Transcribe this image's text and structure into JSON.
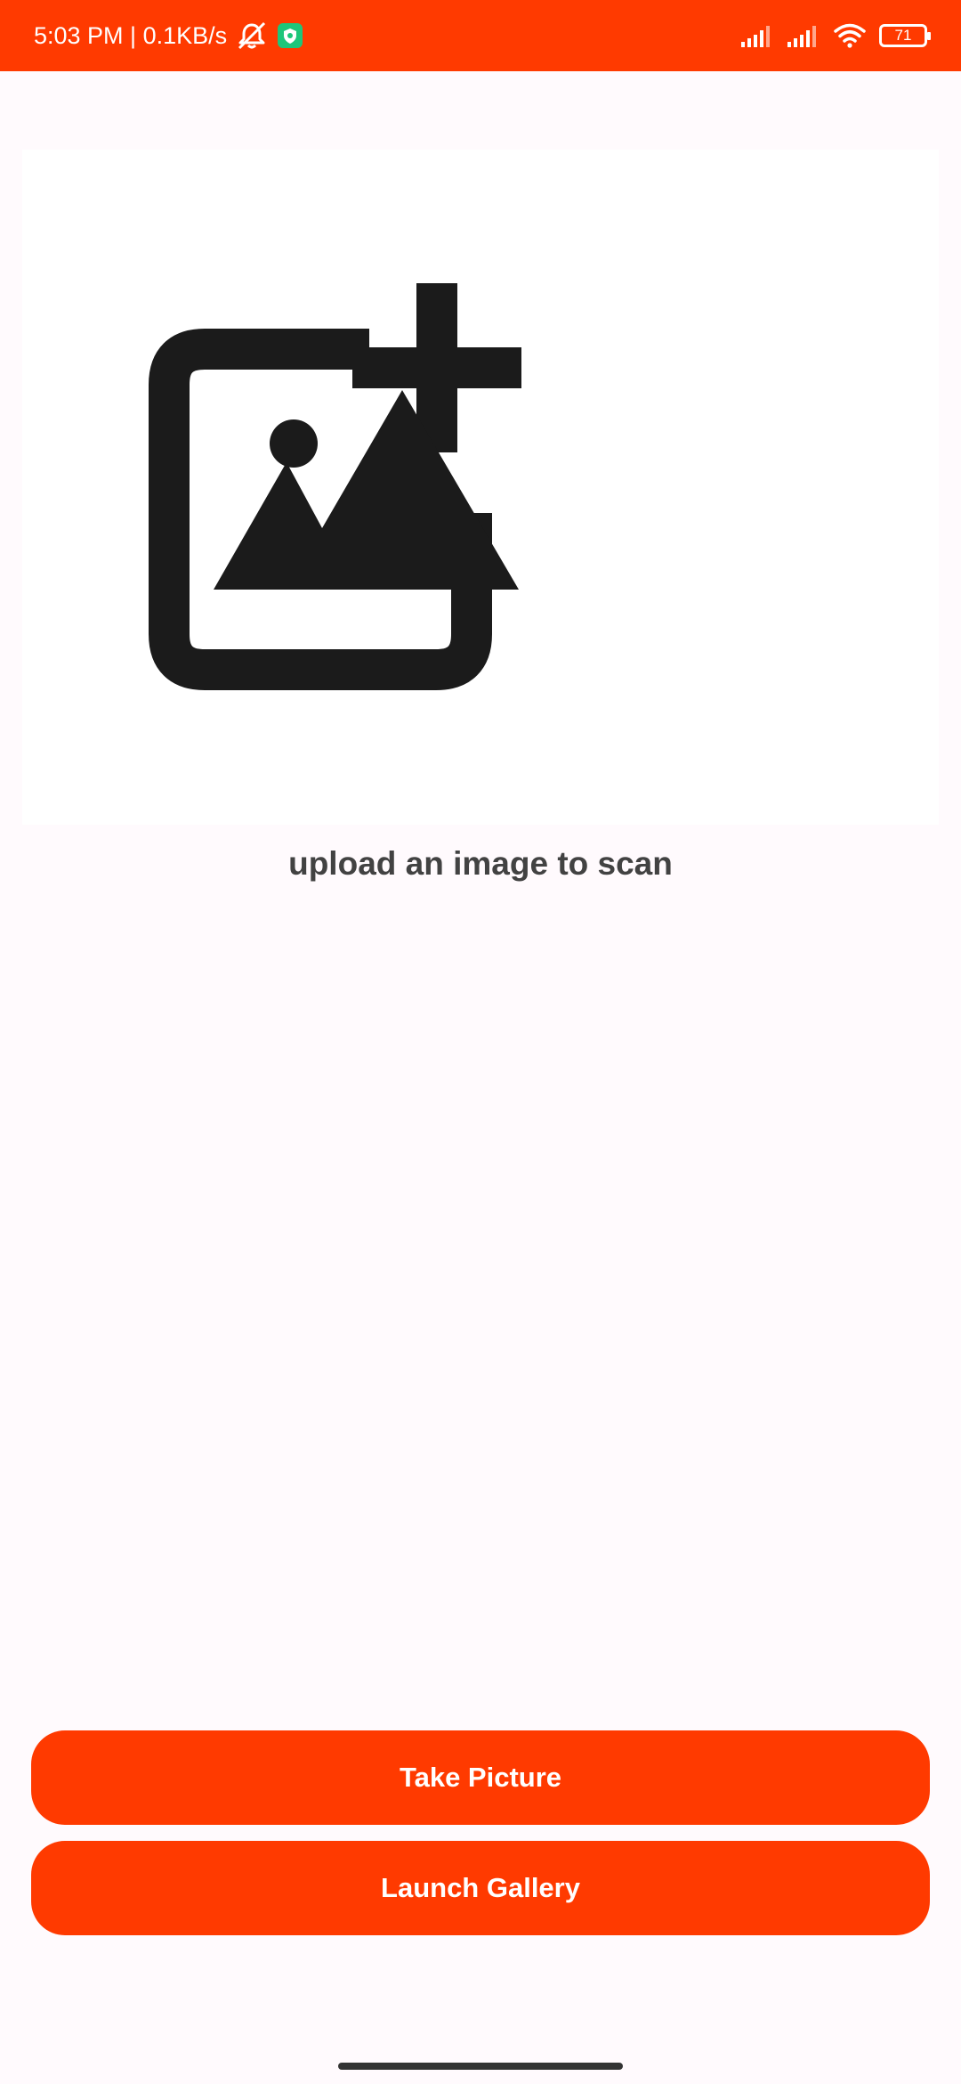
{
  "status_bar": {
    "time_speed": "5:03 PM | 0.1KB/s",
    "battery_level": "71",
    "icons": [
      "mute-icon",
      "shield-icon",
      "signal-icon",
      "signal-icon",
      "wifi-icon",
      "battery-icon"
    ],
    "background_color": "#FF3A00"
  },
  "upload": {
    "icon": "add-photo-icon",
    "prompt": "upload an image to scan"
  },
  "buttons": {
    "take_picture": "Take Picture",
    "launch_gallery": "Launch Gallery",
    "color": "#FF3A00"
  }
}
